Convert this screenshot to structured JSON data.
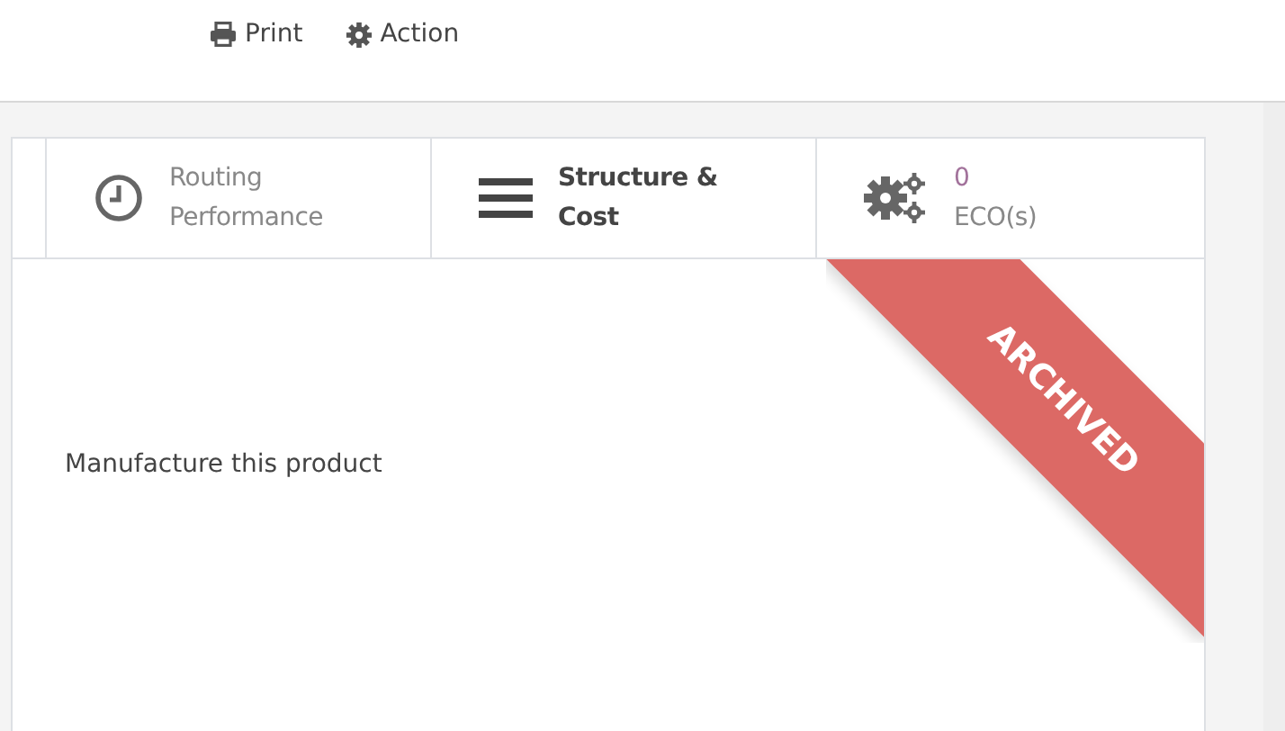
{
  "actions": [
    {
      "label": "Print"
    },
    {
      "label": "Action"
    }
  ],
  "stat_buttons": [
    {
      "kind": "label",
      "lines": [
        "Routing",
        "Performance"
      ]
    },
    {
      "kind": "strong",
      "lines": [
        "Structure &",
        "Cost"
      ]
    },
    {
      "kind": "stat",
      "value": "0",
      "label": "ECO(s)"
    }
  ],
  "ribbon": "ARCHIVED",
  "body_text": "Manufacture this product"
}
